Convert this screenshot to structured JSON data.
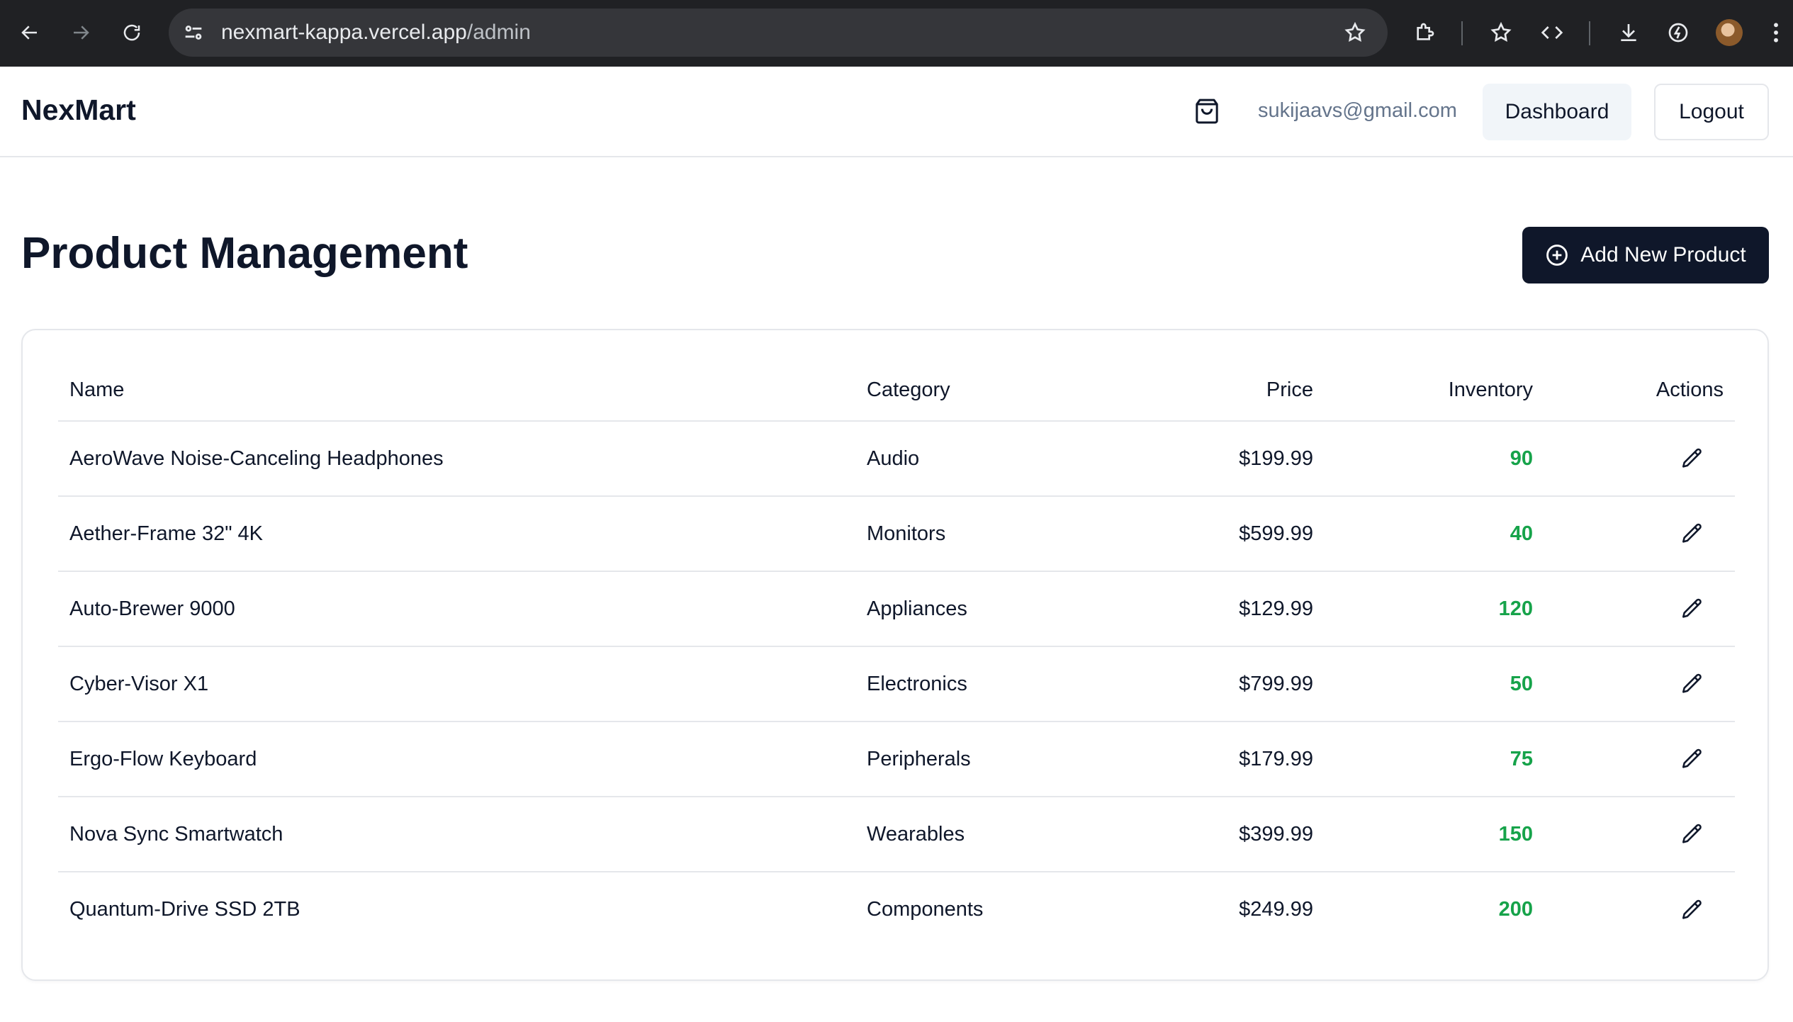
{
  "browser": {
    "url_host": "nexmart-kappa.vercel.app",
    "url_path": "/admin"
  },
  "header": {
    "brand": "NexMart",
    "user_email": "sukijaavs@gmail.com",
    "dashboard_label": "Dashboard",
    "logout_label": "Logout"
  },
  "page": {
    "title": "Product Management",
    "add_button_label": "Add New Product"
  },
  "table": {
    "columns": [
      "Name",
      "Category",
      "Price",
      "Inventory",
      "Actions"
    ],
    "rows": [
      {
        "name": "AeroWave Noise-Canceling Headphones",
        "category": "Audio",
        "price": "$199.99",
        "inventory": "90"
      },
      {
        "name": "Aether-Frame 32\" 4K",
        "category": "Monitors",
        "price": "$599.99",
        "inventory": "40"
      },
      {
        "name": "Auto-Brewer 9000",
        "category": "Appliances",
        "price": "$129.99",
        "inventory": "120"
      },
      {
        "name": "Cyber-Visor X1",
        "category": "Electronics",
        "price": "$799.99",
        "inventory": "50"
      },
      {
        "name": "Ergo-Flow Keyboard",
        "category": "Peripherals",
        "price": "$179.99",
        "inventory": "75"
      },
      {
        "name": "Nova Sync Smartwatch",
        "category": "Wearables",
        "price": "$399.99",
        "inventory": "150"
      },
      {
        "name": "Quantum-Drive SSD 2TB",
        "category": "Components",
        "price": "$249.99",
        "inventory": "200"
      }
    ]
  },
  "colors": {
    "primary": "#0f172a",
    "inventory_ok": "#16a34a",
    "border": "#e5e7eb"
  },
  "icons": {
    "cart": "shopping-bag-icon",
    "add": "plus-circle-icon",
    "edit": "pencil-icon"
  }
}
